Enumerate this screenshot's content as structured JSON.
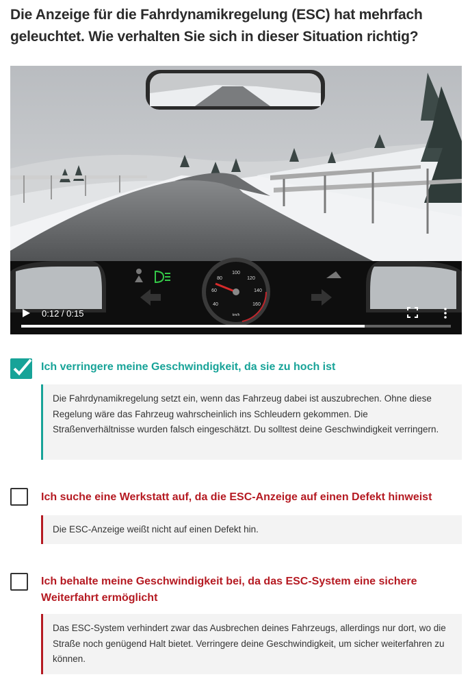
{
  "question": "Die Anzeige für die Fahrdynamikregelung (ESC) hat mehrfach geleuchtet. Wie verhalten Sie sich in dieser Situation richtig?",
  "video": {
    "time": "0:12 / 0:15",
    "progress": 0.8,
    "speedometer_ticks": [
      "40",
      "60",
      "80",
      "100",
      "120",
      "140",
      "160"
    ],
    "speedometer_unit": "km/h"
  },
  "answers": [
    {
      "checked": true,
      "label": "Ich verringere meine Geschwindigkeit, da sie zu hoch ist",
      "explanation": "Die Fahrdynamikregelung setzt ein, wenn das Fahrzeug dabei ist auszubrechen. Ohne diese Regelung wäre das Fahrzeug wahrscheinlich ins Schleudern gekommen. Die Straßenverhältnisse wurden falsch eingeschätzt. Du solltest deine Geschwindigkeit verringern."
    },
    {
      "checked": false,
      "label": "Ich suche eine Werkstatt auf, da die ESC-Anzeige auf einen Defekt hinweist",
      "explanation": "Die ESC-Anzeige weißt nicht auf einen Defekt hin."
    },
    {
      "checked": false,
      "label": "Ich behalte meine Geschwindigkeit bei, da das ESC-System eine sichere Weiterfahrt ermöglicht",
      "explanation": "Das ESC-System verhindert zwar das Ausbrechen deines Fahrzeugs, allerdings nur dort, wo die Straße noch genügend Halt bietet. Verringere deine Geschwindigkeit, um sicher weiterfahren zu können."
    }
  ],
  "colors": {
    "correct": "#17a398",
    "wrong": "#b51a22",
    "explanation_bg": "#f3f3f3"
  },
  "icons": [
    "checkmark-icon",
    "play-icon",
    "fullscreen-icon",
    "more-vert-icon",
    "airbag-icon",
    "low-beam-icon",
    "esc-icon",
    "arrow-left-icon",
    "arrow-right-icon"
  ]
}
